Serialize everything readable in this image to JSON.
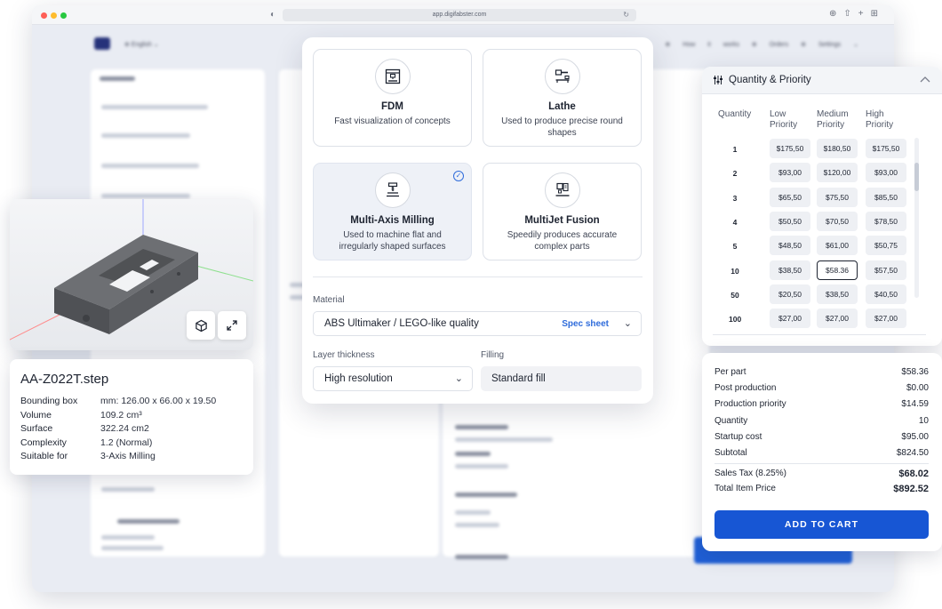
{
  "browser": {
    "url": "app.digifabster.com"
  },
  "technologies": [
    {
      "name": "FDM",
      "description": "Fast visualization of concepts",
      "selected": false
    },
    {
      "name": "Lathe",
      "description": "Used to produce precise round shapes",
      "selected": false
    },
    {
      "name": "Multi-Axis Milling",
      "description": "Used to machine flat and irregularly shaped surfaces",
      "selected": true
    },
    {
      "name": "MultiJet Fusion",
      "description": "Speedily produces accurate complex parts",
      "selected": false
    }
  ],
  "material": {
    "label": "Material",
    "value": "ABS Ultimaker / LEGO-like quality",
    "spec_link": "Spec sheet"
  },
  "layer_thickness": {
    "label": "Layer thickness",
    "value": "High resolution"
  },
  "filling": {
    "label": "Filling",
    "value": "Standard fill"
  },
  "model": {
    "name": "AA-Z022T.step",
    "specs": [
      {
        "key": "Bounding box",
        "value": "mm: 126.00 x 66.00 x 19.50"
      },
      {
        "key": "Volume",
        "value": "109.2 cm³"
      },
      {
        "key": "Surface",
        "value": "322.24 cm2"
      },
      {
        "key": "Complexity",
        "value": "1.2 (Normal)"
      },
      {
        "key": "Suitable for",
        "value": "3-Axis Milling"
      }
    ]
  },
  "quantity_priority": {
    "title": "Quantity & Priority",
    "headers": {
      "quantity": "Quantity",
      "low": "Low Priority",
      "medium": "Medium Priority",
      "high": "High Priority"
    },
    "rows": [
      {
        "qty": "1",
        "low": "$175,50",
        "medium": "$180,50",
        "high": "$175,50"
      },
      {
        "qty": "2",
        "low": "$93,00",
        "medium": "$120,00",
        "high": "$93,00"
      },
      {
        "qty": "3",
        "low": "$65,50",
        "medium": "$75,50",
        "high": "$85,50"
      },
      {
        "qty": "4",
        "low": "$50,50",
        "medium": "$70,50",
        "high": "$78,50"
      },
      {
        "qty": "5",
        "low": "$48,50",
        "medium": "$61,00",
        "high": "$50,75"
      },
      {
        "qty": "10",
        "low": "$38,50",
        "medium": "$58.36",
        "high": "$57,50"
      },
      {
        "qty": "50",
        "low": "$20,50",
        "medium": "$38,50",
        "high": "$40,50"
      },
      {
        "qty": "100",
        "low": "$27,00",
        "medium": "$27,00",
        "high": "$27,00"
      }
    ],
    "selected": {
      "qty": "10",
      "priority": "medium"
    }
  },
  "pricing": {
    "rows": [
      {
        "label": "Per part",
        "value": "$58.36"
      },
      {
        "label": "Post production",
        "value": "$0.00"
      },
      {
        "label": "Production priority",
        "value": "$14.59"
      },
      {
        "label": "Quantity",
        "value": "10"
      },
      {
        "label": "Startup cost",
        "value": "$95.00"
      },
      {
        "label": "Subtotal",
        "value": "$824.50"
      }
    ],
    "sales_tax": {
      "label": "Sales Tax (8.25%)",
      "value": "$68.02"
    },
    "total": {
      "label": "Total Item Price",
      "value": "$892.52"
    },
    "add_to_cart": "ADD TO CART"
  },
  "colors": {
    "accent": "#1756d4",
    "link": "#2f6cdb",
    "cell": "#eef0f4"
  }
}
